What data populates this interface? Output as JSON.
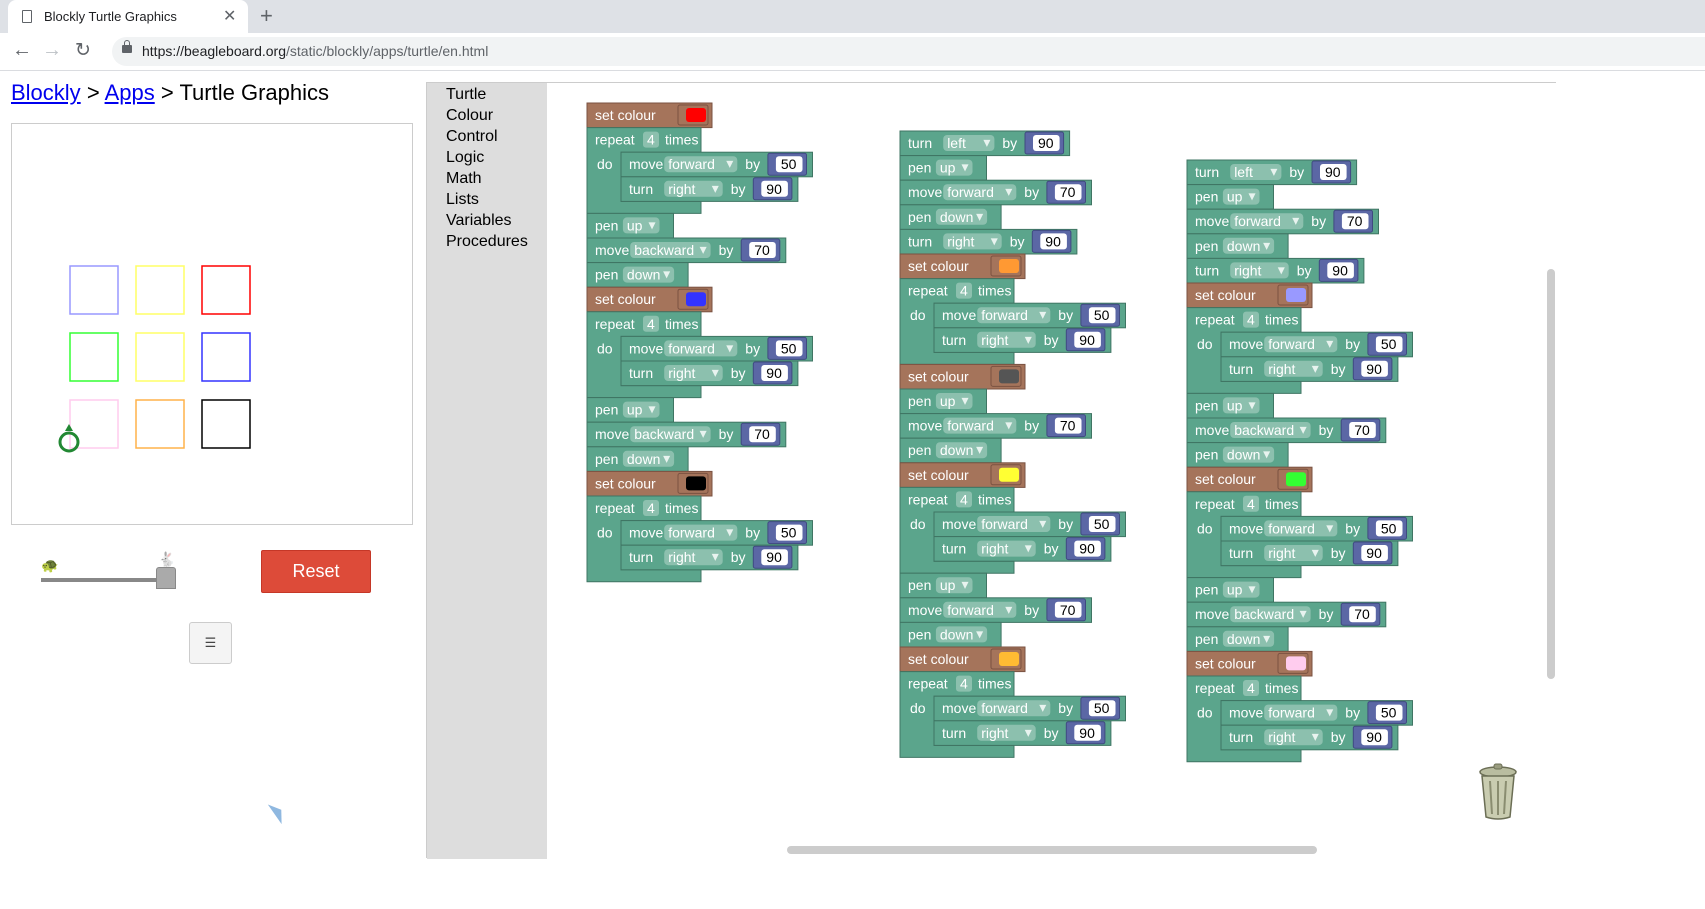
{
  "browser": {
    "tab_title": "Blockly Turtle Graphics",
    "url_host": "https://beagleboard.org",
    "url_path": "/static/blockly/apps/turtle/en.html"
  },
  "breadcrumb": {
    "link1": "Blockly",
    "sep1": ">",
    "link2": "Apps",
    "sep2": ">",
    "current": "Turtle Graphics"
  },
  "controls": {
    "reset_label": "Reset",
    "speed_level": 0.95
  },
  "toolbox": [
    "Turtle",
    "Colour",
    "Control",
    "Logic",
    "Math",
    "Lists",
    "Variables",
    "Procedures"
  ],
  "drawing": {
    "squares": [
      {
        "color": "#9999ff",
        "row": 0,
        "col": 0
      },
      {
        "color": "#ffff66",
        "row": 0,
        "col": 1
      },
      {
        "color": "#ff0000",
        "row": 0,
        "col": 2
      },
      {
        "color": "#33ff33",
        "row": 1,
        "col": 0
      },
      {
        "color": "#ffff66",
        "row": 1,
        "col": 1
      },
      {
        "color": "#3333ff",
        "row": 1,
        "col": 2
      },
      {
        "color": "#ffccee",
        "row": 2,
        "col": 0
      },
      {
        "color": "#ffb24a",
        "row": 2,
        "col": 1
      },
      {
        "color": "#000000",
        "row": 2,
        "col": 2
      }
    ]
  },
  "labels": {
    "set_colour": "set colour",
    "repeat": "repeat",
    "times": "times",
    "do": "do",
    "move": "move",
    "turn": "turn",
    "pen": "pen",
    "by": "by"
  },
  "colors": {
    "turtle_block": "#5ba58c",
    "colour_block": "#a5745b",
    "math_block": "#5b67a5"
  },
  "programs": [
    {
      "stack": [
        {
          "t": "colour",
          "c": "#ff0000"
        },
        {
          "t": "repeat",
          "n": "4",
          "body": [
            {
              "t": "move",
              "d": "forward",
              "v": "50"
            },
            {
              "t": "turn",
              "d": "right",
              "v": "90"
            }
          ]
        },
        {
          "t": "pen",
          "d": "up"
        },
        {
          "t": "move",
          "d": "backward",
          "v": "70"
        },
        {
          "t": "pen",
          "d": "down"
        },
        {
          "t": "colour",
          "c": "#3333ff"
        },
        {
          "t": "repeat",
          "n": "4",
          "body": [
            {
              "t": "move",
              "d": "forward",
              "v": "50"
            },
            {
              "t": "turn",
              "d": "right",
              "v": "90"
            }
          ]
        },
        {
          "t": "pen",
          "d": "up"
        },
        {
          "t": "move",
          "d": "backward",
          "v": "70"
        },
        {
          "t": "pen",
          "d": "down"
        },
        {
          "t": "colour",
          "c": "#000000"
        },
        {
          "t": "repeat",
          "n": "4",
          "body": [
            {
              "t": "move",
              "d": "forward",
              "v": "50"
            },
            {
              "t": "turn",
              "d": "right",
              "v": "90"
            }
          ]
        }
      ]
    },
    {
      "stack": [
        {
          "t": "turn",
          "d": "left",
          "v": "90"
        },
        {
          "t": "pen",
          "d": "up"
        },
        {
          "t": "move",
          "d": "forward",
          "v": "70"
        },
        {
          "t": "pen",
          "d": "down"
        },
        {
          "t": "turn",
          "d": "right",
          "v": "90"
        },
        {
          "t": "colour",
          "c": "#ff9933"
        },
        {
          "t": "repeat",
          "n": "4",
          "body": [
            {
              "t": "move",
              "d": "forward",
              "v": "50"
            },
            {
              "t": "turn",
              "d": "right",
              "v": "90"
            }
          ]
        },
        {
          "t": "colour",
          "c": "#555555"
        },
        {
          "t": "pen",
          "d": "up"
        },
        {
          "t": "move",
          "d": "forward",
          "v": "70"
        },
        {
          "t": "pen",
          "d": "down"
        },
        {
          "t": "colour",
          "c": "#ffff33"
        },
        {
          "t": "repeat",
          "n": "4",
          "body": [
            {
              "t": "move",
              "d": "forward",
              "v": "50"
            },
            {
              "t": "turn",
              "d": "right",
              "v": "90"
            }
          ]
        },
        {
          "t": "pen",
          "d": "up"
        },
        {
          "t": "move",
          "d": "forward",
          "v": "70"
        },
        {
          "t": "pen",
          "d": "down"
        },
        {
          "t": "colour",
          "c": "#ffbb33"
        },
        {
          "t": "repeat",
          "n": "4",
          "body": [
            {
              "t": "move",
              "d": "forward",
              "v": "50"
            },
            {
              "t": "turn",
              "d": "right",
              "v": "90"
            }
          ]
        }
      ]
    },
    {
      "stack": [
        {
          "t": "turn",
          "d": "left",
          "v": "90"
        },
        {
          "t": "pen",
          "d": "up"
        },
        {
          "t": "move",
          "d": "forward",
          "v": "70"
        },
        {
          "t": "pen",
          "d": "down"
        },
        {
          "t": "turn",
          "d": "right",
          "v": "90"
        },
        {
          "t": "colour",
          "c": "#9999ff"
        },
        {
          "t": "repeat",
          "n": "4",
          "body": [
            {
              "t": "move",
              "d": "forward",
              "v": "50"
            },
            {
              "t": "turn",
              "d": "right",
              "v": "90"
            }
          ]
        },
        {
          "t": "pen",
          "d": "up"
        },
        {
          "t": "move",
          "d": "backward",
          "v": "70"
        },
        {
          "t": "pen",
          "d": "down"
        },
        {
          "t": "colour",
          "c": "#33ff33"
        },
        {
          "t": "repeat",
          "n": "4",
          "body": [
            {
              "t": "move",
              "d": "forward",
              "v": "50"
            },
            {
              "t": "turn",
              "d": "right",
              "v": "90"
            }
          ]
        },
        {
          "t": "pen",
          "d": "up"
        },
        {
          "t": "move",
          "d": "backward",
          "v": "70"
        },
        {
          "t": "pen",
          "d": "down"
        },
        {
          "t": "colour",
          "c": "#ffccee"
        },
        {
          "t": "repeat",
          "n": "4",
          "body": [
            {
              "t": "move",
              "d": "forward",
              "v": "50"
            },
            {
              "t": "turn",
              "d": "right",
              "v": "90"
            }
          ]
        }
      ]
    }
  ]
}
